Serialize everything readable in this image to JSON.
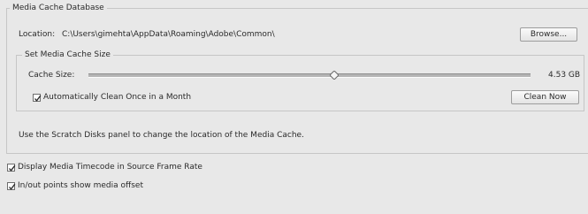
{
  "media_cache_database": {
    "title": "Media Cache Database",
    "location_label": "Location:",
    "location_path": "C:\\Users\\gimehta\\AppData\\Roaming\\Adobe\\Common\\",
    "browse_label": "Browse...",
    "set_cache_size": {
      "title": "Set Media Cache Size",
      "cache_size_label": "Cache Size:",
      "cache_size_value": "4.53 GB",
      "slider_level": 0.555,
      "auto_clean_label": "Automatically Clean Once in a Month",
      "auto_clean_checked": true,
      "clean_now_label": "Clean Now"
    },
    "scratch_disks_note": "Use the Scratch Disks panel to change the location of the Media Cache."
  },
  "options": [
    {
      "label": "Display Media Timecode in Source Frame Rate",
      "checked": true
    },
    {
      "label": "In/out points show media offset",
      "checked": true
    }
  ]
}
